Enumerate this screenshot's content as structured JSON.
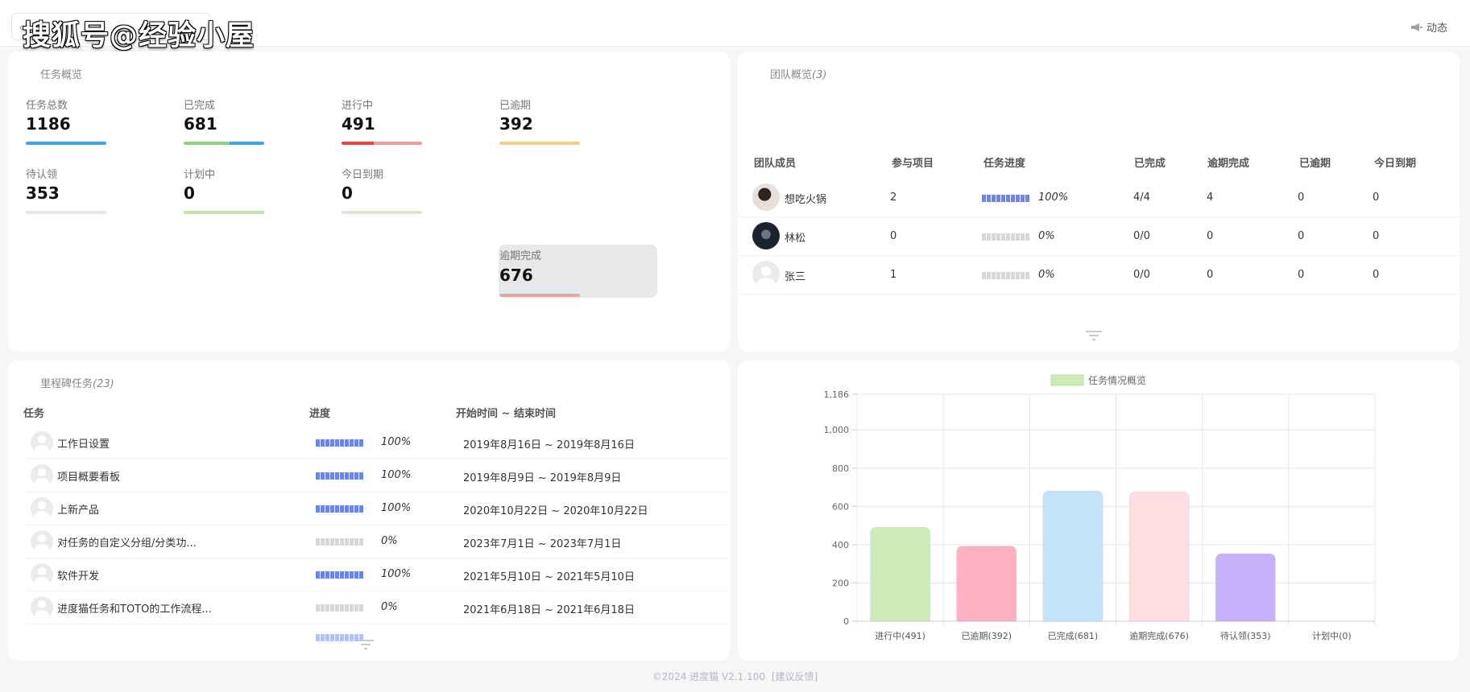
{
  "topbar": {
    "watermark": "搜狐号@经验小屋",
    "activity_label": "动态"
  },
  "task_overview": {
    "title": "任务概览",
    "stats": [
      {
        "label": "任务总数",
        "value": "1186",
        "bar": [
          {
            "pct": 100,
            "color": "#3aa4ee"
          }
        ]
      },
      {
        "label": "已完成",
        "value": "681",
        "bar": [
          {
            "pct": 57,
            "color": "#8fd27c"
          },
          {
            "pct": 43,
            "color": "#3aa4ee"
          }
        ]
      },
      {
        "label": "进行中",
        "value": "491",
        "bar": [
          {
            "pct": 40,
            "color": "#e8463a"
          },
          {
            "pct": 60,
            "color": "#ea9b9b"
          }
        ]
      },
      {
        "label": "已逾期",
        "value": "392",
        "bar": [
          {
            "pct": 100,
            "color": "#f0d27e"
          }
        ]
      },
      {
        "label": "待认领",
        "value": "353",
        "bar": [
          {
            "pct": 100,
            "color": "#e6e6e6"
          }
        ]
      },
      {
        "label": "计划中",
        "value": "0",
        "bar": [
          {
            "pct": 100,
            "color": "#bfe3a7"
          }
        ]
      },
      {
        "label": "今日到期",
        "value": "0",
        "bar": [
          {
            "pct": 100,
            "color": "#dfe5cf"
          }
        ]
      },
      {
        "label": "逾期完成",
        "value": "676",
        "bar": [
          {
            "pct": 100,
            "color": "#eaa3a5"
          }
        ]
      }
    ]
  },
  "team_overview": {
    "title": "团队概览",
    "count": "(3)",
    "columns": [
      "团队成员",
      "参与项目",
      "任务进度",
      "已完成",
      "逾期完成",
      "已逾期",
      "今日到期"
    ],
    "rows": [
      {
        "name": "想吃火锅",
        "avatar": "photo-light",
        "projects": "2",
        "progress": 100,
        "progress_label": "100%",
        "done": "4/4",
        "late_done": "4",
        "overdue": "0",
        "due_today": "0"
      },
      {
        "name": "林松",
        "avatar": "photo-dark",
        "projects": "0",
        "progress": 0,
        "progress_label": "0%",
        "done": "0/0",
        "late_done": "0",
        "overdue": "0",
        "due_today": "0"
      },
      {
        "name": "张三",
        "avatar": "placeholder",
        "projects": "1",
        "progress": 0,
        "progress_label": "0%",
        "done": "0/0",
        "late_done": "0",
        "overdue": "0",
        "due_today": "0"
      }
    ]
  },
  "milestones": {
    "title": "里程碑任务",
    "count": "(23)",
    "columns": [
      "任务",
      "进度",
      "开始时间 ~ 结束时间"
    ],
    "rows": [
      {
        "name": "工作日设置",
        "progress": 100,
        "progress_label": "100%",
        "dates": "2019年8月16日 ~ 2019年8月16日"
      },
      {
        "name": "项目概要看板",
        "progress": 100,
        "progress_label": "100%",
        "dates": "2019年8月9日 ~ 2019年8月9日"
      },
      {
        "name": "上新产品",
        "progress": 100,
        "progress_label": "100%",
        "dates": "2020年10月22日 ~ 2020年10月22日"
      },
      {
        "name": "对任务的自定义分组/分类功...",
        "progress": 0,
        "progress_label": "0%",
        "dates": "2023年7月1日 ~ 2023年7月1日"
      },
      {
        "name": "软件开发",
        "progress": 100,
        "progress_label": "100%",
        "dates": "2021年5月10日 ~ 2021年5月10日"
      },
      {
        "name": "进度猫任务和TOTO的工作流程...",
        "progress": 0,
        "progress_label": "0%",
        "dates": "2021年6月18日 ~ 2021年6月18日"
      }
    ]
  },
  "chart_data": {
    "type": "bar",
    "legend": "任务情况概览",
    "legend_position": "top-center",
    "categories": [
      "进行中(491)",
      "已逾期(392)",
      "已完成(681)",
      "逾期完成(676)",
      "待认领(353)",
      "计划中(0)"
    ],
    "values": [
      491,
      392,
      681,
      676,
      353,
      0
    ],
    "colors": [
      "#cdebb8",
      "#ffb0c1",
      "#c3e4f8",
      "#ffdee1",
      "#c9b0fb",
      "#e0e0e0"
    ],
    "yticks": [
      "0",
      "200",
      "400",
      "600",
      "800",
      "1,000",
      "1,186"
    ],
    "ylim": [
      0,
      1186
    ],
    "grid": true
  },
  "footer": {
    "text": "©2024 进度猫 V2.1.100",
    "feedback": "[建议反馈]"
  }
}
